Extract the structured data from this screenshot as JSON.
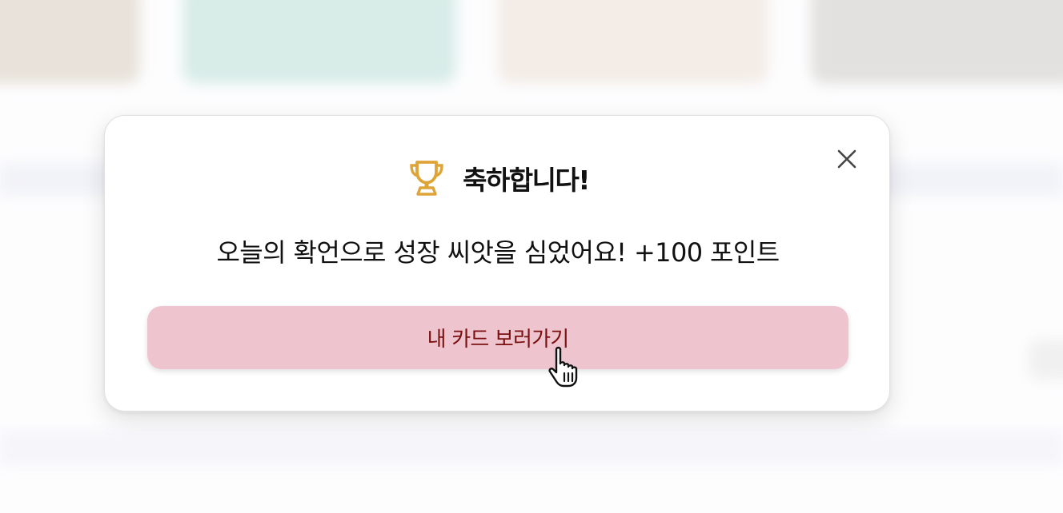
{
  "dialog": {
    "title": "축하합니다!",
    "message": "오늘의 확언으로 성장 씨앗을 심었어요! +100 포인트",
    "cta_label": "내 카드 보러가기",
    "close_icon": "close-icon",
    "title_icon": "trophy-icon"
  },
  "colors": {
    "trophy": "#dfa437",
    "cta_background": "#eec4cf",
    "cta_text": "#7a1010",
    "text": "#111111"
  }
}
